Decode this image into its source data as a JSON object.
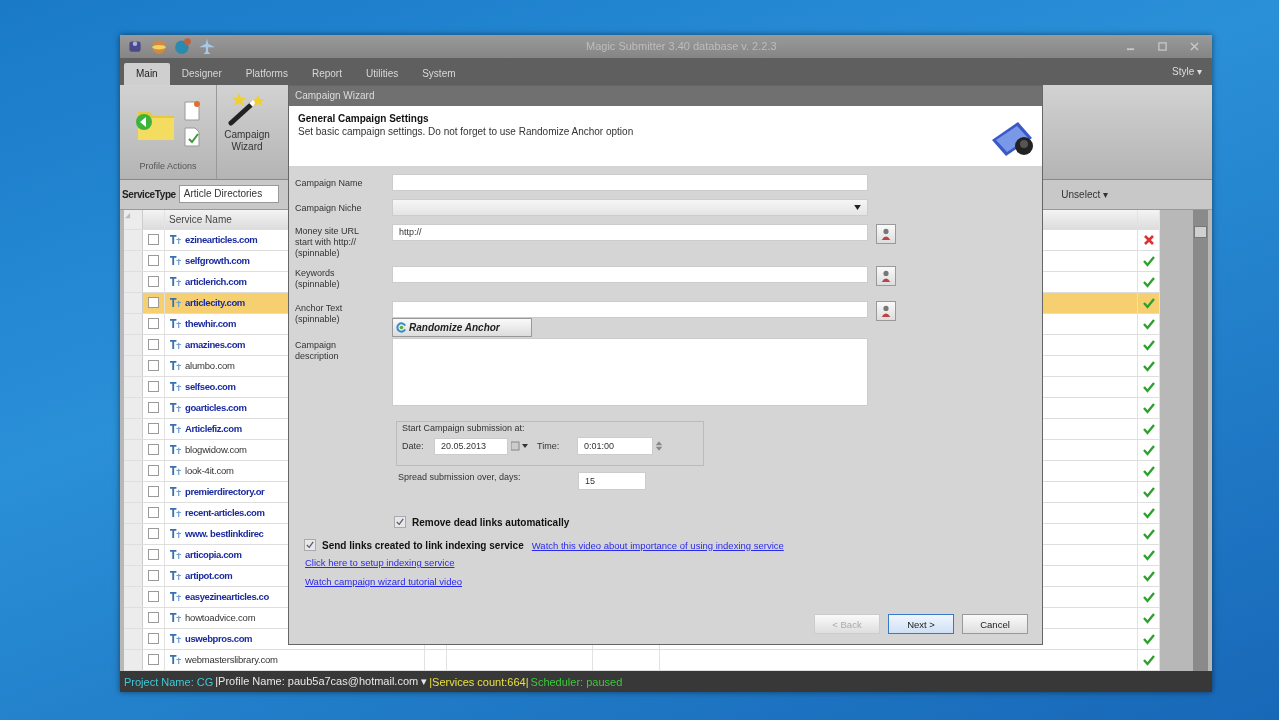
{
  "window": {
    "title": "Magic Submitter 3.40 database v. 2.2.3"
  },
  "ribbon_tabs": [
    {
      "label": "Main",
      "selected": true
    },
    {
      "label": "Designer",
      "selected": false
    },
    {
      "label": "Platforms",
      "selected": false
    },
    {
      "label": "Report",
      "selected": false
    },
    {
      "label": "Utilities",
      "selected": false
    },
    {
      "label": "System",
      "selected": false
    }
  ],
  "style_menu": "Style ▾",
  "ribbon": {
    "group_label": "Profile Actions",
    "wizard_button": "Campaign Wizard"
  },
  "service_type": {
    "label": "ServiceType",
    "value": "Article Directories",
    "unselect": "Unselect ▾"
  },
  "table": {
    "columns": [
      "Service Name"
    ],
    "rows": [
      {
        "name": "ezinearticles.com",
        "kind": "bold",
        "checked": false,
        "selected": false,
        "ok": false
      },
      {
        "name": "selfgrowth.com",
        "kind": "bold",
        "checked": false,
        "selected": false,
        "ok": true
      },
      {
        "name": "articlerich.com",
        "kind": "bold",
        "checked": false,
        "selected": false,
        "ok": true
      },
      {
        "name": "articlecity.com",
        "kind": "bold",
        "checked": false,
        "selected": true,
        "ok": true
      },
      {
        "name": "thewhir.com",
        "kind": "bold",
        "checked": false,
        "selected": false,
        "ok": true
      },
      {
        "name": "amazines.com",
        "kind": "bold",
        "checked": false,
        "selected": false,
        "ok": true
      },
      {
        "name": "alumbo.com",
        "kind": "plain",
        "checked": false,
        "selected": false,
        "ok": true
      },
      {
        "name": "selfseo.com",
        "kind": "bold",
        "checked": false,
        "selected": false,
        "ok": true
      },
      {
        "name": "goarticles.com",
        "kind": "bold",
        "checked": false,
        "selected": false,
        "ok": true
      },
      {
        "name": "Articlefiz.com",
        "kind": "bold",
        "checked": false,
        "selected": false,
        "ok": true
      },
      {
        "name": "blogwidow.com",
        "kind": "plain",
        "checked": false,
        "selected": false,
        "ok": true
      },
      {
        "name": "look-4it.com",
        "kind": "plain",
        "checked": false,
        "selected": false,
        "ok": true
      },
      {
        "name": "premierdirectory.or",
        "kind": "bold",
        "checked": false,
        "selected": false,
        "ok": true
      },
      {
        "name": "recent-articles.com",
        "kind": "bold",
        "checked": false,
        "selected": false,
        "ok": true
      },
      {
        "name": "www. bestlinkdirec",
        "kind": "bold",
        "checked": false,
        "selected": false,
        "ok": true
      },
      {
        "name": "articopia.com",
        "kind": "bold",
        "checked": false,
        "selected": false,
        "ok": true
      },
      {
        "name": "artipot.com",
        "kind": "bold",
        "checked": false,
        "selected": false,
        "ok": true
      },
      {
        "name": "easyezinearticles.co",
        "kind": "bold",
        "checked": false,
        "selected": false,
        "ok": true
      },
      {
        "name": "howtoadvice.com",
        "kind": "plain",
        "checked": false,
        "selected": false,
        "ok": true
      },
      {
        "name": "uswebpros.com",
        "kind": "bold",
        "checked": false,
        "selected": false,
        "ok": true
      },
      {
        "name": "webmasterslibrary.com",
        "kind": "plain",
        "checked": false,
        "selected": false,
        "ok": true
      }
    ]
  },
  "status_bar": [
    {
      "text": "Project Name: CG",
      "color": "#3fc8d8"
    },
    {
      "text": "|Profile Name:  paub5a7cas@hotmail.com ▾",
      "color": "#e8e8e8"
    },
    {
      "text": "|Services count:664|",
      "color": "#e8e040"
    },
    {
      "text": "Scheduler: paused",
      "color": "#3cc83c"
    }
  ],
  "dialog": {
    "title": "Campaign Wizard",
    "heading": "General Campaign Settings",
    "subheading": "Set basic campaign settings. Do not forget to use Randomize Anchor option",
    "campaign_name": {
      "label": "Campaign Name"
    },
    "campaign_niche": {
      "label": "Campaign Niche"
    },
    "money_site_url": {
      "label": "Money site URL start with http:// (spinnable)",
      "value": "http://"
    },
    "keywords": {
      "label": "Keywords (spinnable)"
    },
    "anchor_text": {
      "label": "Anchor Text (spinnable)"
    },
    "randomize_button": "Randomize Anchor",
    "description": {
      "label": "Campaign description"
    },
    "start": {
      "legend": "Start Campaign submission at:",
      "date_label": "Date:",
      "date": "20.05.2013",
      "time_label": "Time:",
      "time": "0:01:00"
    },
    "spread": {
      "label": "Spread submission over, days:",
      "value": "15"
    },
    "remove_dead": {
      "label": "Remove dead links automatically",
      "checked": true
    },
    "send_links": {
      "label": "Send links created to link indexing service",
      "checked": true,
      "link": "Watch this video about importance of using indexing service"
    },
    "links": [
      "Click here to setup indexing service",
      "Watch campaign wizard tutorial video"
    ],
    "buttons": [
      {
        "label": "< Back",
        "disabled": true,
        "default": false
      },
      {
        "label": "Next >",
        "disabled": false,
        "default": true
      },
      {
        "label": "Cancel",
        "disabled": false,
        "default": false
      }
    ]
  }
}
